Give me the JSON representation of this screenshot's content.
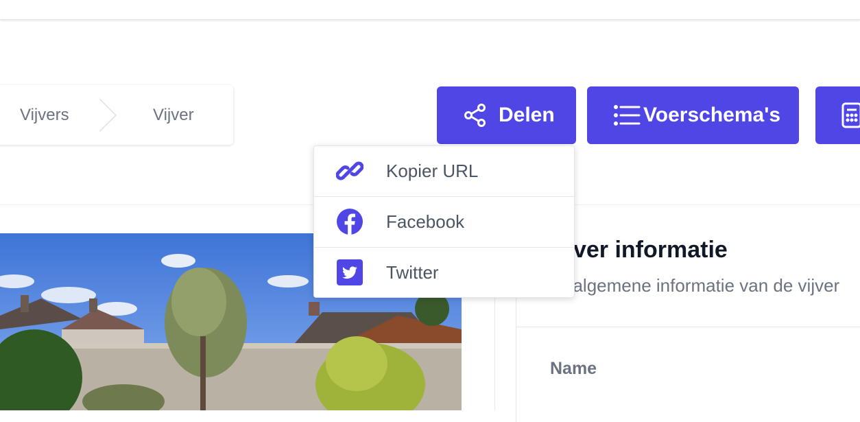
{
  "breadcrumb": {
    "items": [
      "Vijvers",
      "Vijver"
    ]
  },
  "actions": {
    "share_label": "Delen",
    "schedules_label": "Voerschema's"
  },
  "share_menu": {
    "items": [
      {
        "label": "Kopier URL",
        "icon": "link-icon"
      },
      {
        "label": "Facebook",
        "icon": "facebook-icon"
      },
      {
        "label": "Twitter",
        "icon": "twitter-icon"
      }
    ]
  },
  "info_card": {
    "title": "Vijver informatie",
    "subtitle": "De algemene informatie van de vijver",
    "field_name_label": "Name"
  },
  "colors": {
    "accent": "#4f46e5"
  }
}
